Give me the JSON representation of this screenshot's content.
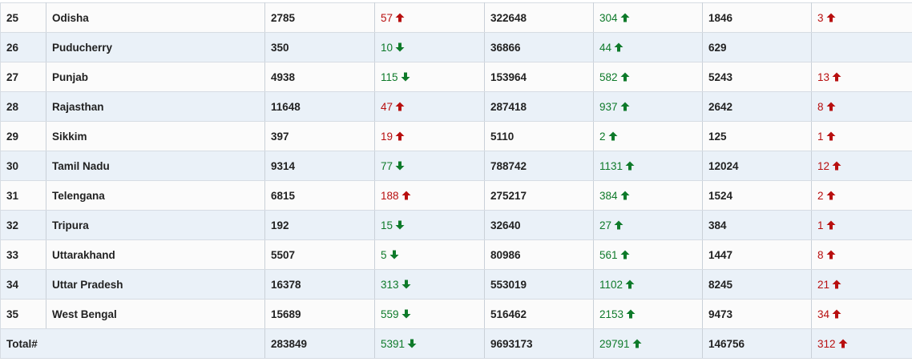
{
  "colors": {
    "red": "#b80f0f",
    "green": "#0e7a2a"
  },
  "rows": [
    {
      "sno": "25",
      "state": "Odisha",
      "active": "2785",
      "active_chg": {
        "value": "57",
        "color": "red",
        "dir": "up"
      },
      "cured": "322648",
      "cured_chg": {
        "value": "304",
        "color": "green",
        "dir": "up"
      },
      "deaths": "1846",
      "deaths_chg": {
        "value": "3",
        "color": "red",
        "dir": "up"
      }
    },
    {
      "sno": "26",
      "state": "Puducherry",
      "active": "350",
      "active_chg": {
        "value": "10",
        "color": "green",
        "dir": "down"
      },
      "cured": "36866",
      "cured_chg": {
        "value": "44",
        "color": "green",
        "dir": "up"
      },
      "deaths": "629",
      "deaths_chg": null
    },
    {
      "sno": "27",
      "state": "Punjab",
      "active": "4938",
      "active_chg": {
        "value": "115",
        "color": "green",
        "dir": "down"
      },
      "cured": "153964",
      "cured_chg": {
        "value": "582",
        "color": "green",
        "dir": "up"
      },
      "deaths": "5243",
      "deaths_chg": {
        "value": "13",
        "color": "red",
        "dir": "up"
      }
    },
    {
      "sno": "28",
      "state": "Rajasthan",
      "active": "11648",
      "active_chg": {
        "value": "47",
        "color": "red",
        "dir": "up"
      },
      "cured": "287418",
      "cured_chg": {
        "value": "937",
        "color": "green",
        "dir": "up"
      },
      "deaths": "2642",
      "deaths_chg": {
        "value": "8",
        "color": "red",
        "dir": "up"
      }
    },
    {
      "sno": "29",
      "state": "Sikkim",
      "active": "397",
      "active_chg": {
        "value": "19",
        "color": "red",
        "dir": "up"
      },
      "cured": "5110",
      "cured_chg": {
        "value": "2",
        "color": "green",
        "dir": "up"
      },
      "deaths": "125",
      "deaths_chg": {
        "value": "1",
        "color": "red",
        "dir": "up"
      }
    },
    {
      "sno": "30",
      "state": "Tamil Nadu",
      "active": "9314",
      "active_chg": {
        "value": "77",
        "color": "green",
        "dir": "down"
      },
      "cured": "788742",
      "cured_chg": {
        "value": "1131",
        "color": "green",
        "dir": "up"
      },
      "deaths": "12024",
      "deaths_chg": {
        "value": "12",
        "color": "red",
        "dir": "up"
      }
    },
    {
      "sno": "31",
      "state": "Telengana",
      "active": "6815",
      "active_chg": {
        "value": "188",
        "color": "red",
        "dir": "up"
      },
      "cured": "275217",
      "cured_chg": {
        "value": "384",
        "color": "green",
        "dir": "up"
      },
      "deaths": "1524",
      "deaths_chg": {
        "value": "2",
        "color": "red",
        "dir": "up"
      }
    },
    {
      "sno": "32",
      "state": "Tripura",
      "active": "192",
      "active_chg": {
        "value": "15",
        "color": "green",
        "dir": "down"
      },
      "cured": "32640",
      "cured_chg": {
        "value": "27",
        "color": "green",
        "dir": "up"
      },
      "deaths": "384",
      "deaths_chg": {
        "value": "1",
        "color": "red",
        "dir": "up"
      }
    },
    {
      "sno": "33",
      "state": "Uttarakhand",
      "active": "5507",
      "active_chg": {
        "value": "5",
        "color": "green",
        "dir": "down"
      },
      "cured": "80986",
      "cured_chg": {
        "value": "561",
        "color": "green",
        "dir": "up"
      },
      "deaths": "1447",
      "deaths_chg": {
        "value": "8",
        "color": "red",
        "dir": "up"
      }
    },
    {
      "sno": "34",
      "state": "Uttar Pradesh",
      "active": "16378",
      "active_chg": {
        "value": "313",
        "color": "green",
        "dir": "down"
      },
      "cured": "553019",
      "cured_chg": {
        "value": "1102",
        "color": "green",
        "dir": "up"
      },
      "deaths": "8245",
      "deaths_chg": {
        "value": "21",
        "color": "red",
        "dir": "up"
      }
    },
    {
      "sno": "35",
      "state": "West Bengal",
      "active": "15689",
      "active_chg": {
        "value": "559",
        "color": "green",
        "dir": "down"
      },
      "cured": "516462",
      "cured_chg": {
        "value": "2153",
        "color": "green",
        "dir": "up"
      },
      "deaths": "9473",
      "deaths_chg": {
        "value": "34",
        "color": "red",
        "dir": "up"
      }
    }
  ],
  "total": {
    "label": "Total#",
    "active": "283849",
    "active_chg": {
      "value": "5391",
      "color": "green",
      "dir": "down"
    },
    "cured": "9693173",
    "cured_chg": {
      "value": "29791",
      "color": "green",
      "dir": "up"
    },
    "deaths": "146756",
    "deaths_chg": {
      "value": "312",
      "color": "red",
      "dir": "up"
    }
  },
  "icons": {
    "up": "arrow-up-icon",
    "down": "arrow-down-icon"
  }
}
